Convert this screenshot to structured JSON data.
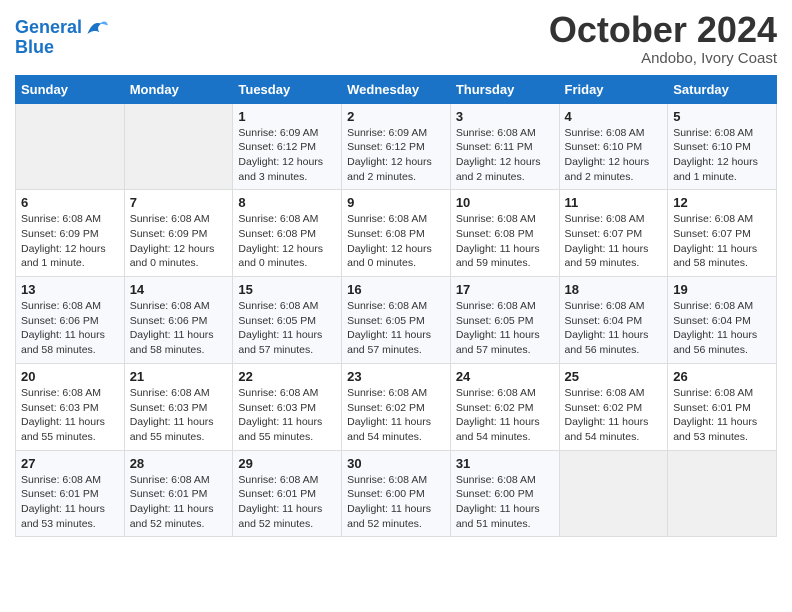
{
  "logo": {
    "line1": "General",
    "line2": "Blue"
  },
  "title": "October 2024",
  "location": "Andobo, Ivory Coast",
  "weekdays": [
    "Sunday",
    "Monday",
    "Tuesday",
    "Wednesday",
    "Thursday",
    "Friday",
    "Saturday"
  ],
  "weeks": [
    [
      {
        "day": "",
        "info": ""
      },
      {
        "day": "",
        "info": ""
      },
      {
        "day": "1",
        "info": "Sunrise: 6:09 AM\nSunset: 6:12 PM\nDaylight: 12 hours\nand 3 minutes."
      },
      {
        "day": "2",
        "info": "Sunrise: 6:09 AM\nSunset: 6:12 PM\nDaylight: 12 hours\nand 2 minutes."
      },
      {
        "day": "3",
        "info": "Sunrise: 6:08 AM\nSunset: 6:11 PM\nDaylight: 12 hours\nand 2 minutes."
      },
      {
        "day": "4",
        "info": "Sunrise: 6:08 AM\nSunset: 6:10 PM\nDaylight: 12 hours\nand 2 minutes."
      },
      {
        "day": "5",
        "info": "Sunrise: 6:08 AM\nSunset: 6:10 PM\nDaylight: 12 hours\nand 1 minute."
      }
    ],
    [
      {
        "day": "6",
        "info": "Sunrise: 6:08 AM\nSunset: 6:09 PM\nDaylight: 12 hours\nand 1 minute."
      },
      {
        "day": "7",
        "info": "Sunrise: 6:08 AM\nSunset: 6:09 PM\nDaylight: 12 hours\nand 0 minutes."
      },
      {
        "day": "8",
        "info": "Sunrise: 6:08 AM\nSunset: 6:08 PM\nDaylight: 12 hours\nand 0 minutes."
      },
      {
        "day": "9",
        "info": "Sunrise: 6:08 AM\nSunset: 6:08 PM\nDaylight: 12 hours\nand 0 minutes."
      },
      {
        "day": "10",
        "info": "Sunrise: 6:08 AM\nSunset: 6:08 PM\nDaylight: 11 hours\nand 59 minutes."
      },
      {
        "day": "11",
        "info": "Sunrise: 6:08 AM\nSunset: 6:07 PM\nDaylight: 11 hours\nand 59 minutes."
      },
      {
        "day": "12",
        "info": "Sunrise: 6:08 AM\nSunset: 6:07 PM\nDaylight: 11 hours\nand 58 minutes."
      }
    ],
    [
      {
        "day": "13",
        "info": "Sunrise: 6:08 AM\nSunset: 6:06 PM\nDaylight: 11 hours\nand 58 minutes."
      },
      {
        "day": "14",
        "info": "Sunrise: 6:08 AM\nSunset: 6:06 PM\nDaylight: 11 hours\nand 58 minutes."
      },
      {
        "day": "15",
        "info": "Sunrise: 6:08 AM\nSunset: 6:05 PM\nDaylight: 11 hours\nand 57 minutes."
      },
      {
        "day": "16",
        "info": "Sunrise: 6:08 AM\nSunset: 6:05 PM\nDaylight: 11 hours\nand 57 minutes."
      },
      {
        "day": "17",
        "info": "Sunrise: 6:08 AM\nSunset: 6:05 PM\nDaylight: 11 hours\nand 57 minutes."
      },
      {
        "day": "18",
        "info": "Sunrise: 6:08 AM\nSunset: 6:04 PM\nDaylight: 11 hours\nand 56 minutes."
      },
      {
        "day": "19",
        "info": "Sunrise: 6:08 AM\nSunset: 6:04 PM\nDaylight: 11 hours\nand 56 minutes."
      }
    ],
    [
      {
        "day": "20",
        "info": "Sunrise: 6:08 AM\nSunset: 6:03 PM\nDaylight: 11 hours\nand 55 minutes."
      },
      {
        "day": "21",
        "info": "Sunrise: 6:08 AM\nSunset: 6:03 PM\nDaylight: 11 hours\nand 55 minutes."
      },
      {
        "day": "22",
        "info": "Sunrise: 6:08 AM\nSunset: 6:03 PM\nDaylight: 11 hours\nand 55 minutes."
      },
      {
        "day": "23",
        "info": "Sunrise: 6:08 AM\nSunset: 6:02 PM\nDaylight: 11 hours\nand 54 minutes."
      },
      {
        "day": "24",
        "info": "Sunrise: 6:08 AM\nSunset: 6:02 PM\nDaylight: 11 hours\nand 54 minutes."
      },
      {
        "day": "25",
        "info": "Sunrise: 6:08 AM\nSunset: 6:02 PM\nDaylight: 11 hours\nand 54 minutes."
      },
      {
        "day": "26",
        "info": "Sunrise: 6:08 AM\nSunset: 6:01 PM\nDaylight: 11 hours\nand 53 minutes."
      }
    ],
    [
      {
        "day": "27",
        "info": "Sunrise: 6:08 AM\nSunset: 6:01 PM\nDaylight: 11 hours\nand 53 minutes."
      },
      {
        "day": "28",
        "info": "Sunrise: 6:08 AM\nSunset: 6:01 PM\nDaylight: 11 hours\nand 52 minutes."
      },
      {
        "day": "29",
        "info": "Sunrise: 6:08 AM\nSunset: 6:01 PM\nDaylight: 11 hours\nand 52 minutes."
      },
      {
        "day": "30",
        "info": "Sunrise: 6:08 AM\nSunset: 6:00 PM\nDaylight: 11 hours\nand 52 minutes."
      },
      {
        "day": "31",
        "info": "Sunrise: 6:08 AM\nSunset: 6:00 PM\nDaylight: 11 hours\nand 51 minutes."
      },
      {
        "day": "",
        "info": ""
      },
      {
        "day": "",
        "info": ""
      }
    ]
  ]
}
